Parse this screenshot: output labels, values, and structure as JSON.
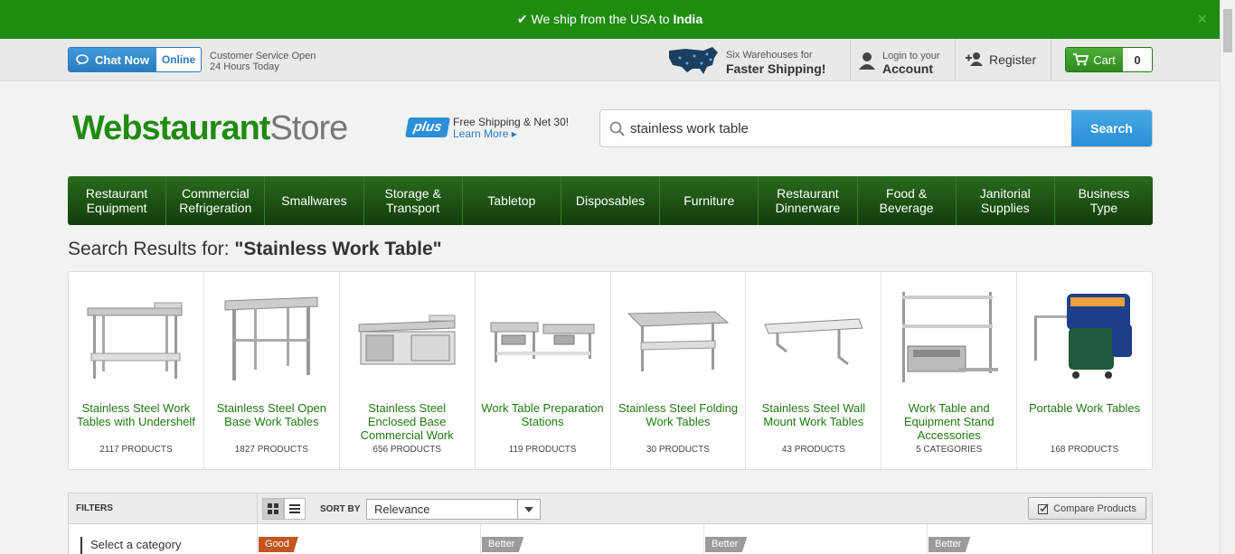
{
  "topbar": {
    "prefix": "We ship from the USA to ",
    "country": "India",
    "close": "×"
  },
  "header": {
    "chat_label": "Chat Now",
    "chat_status": "Online",
    "cs_line1": "Customer Service Open",
    "cs_line2": "24 Hours Today",
    "warehouse_line1": "Six Warehouses for",
    "warehouse_line2": "Faster Shipping!",
    "login_line1": "Login to your",
    "login_line2": "Account",
    "register": "Register",
    "cart_label": "Cart",
    "cart_count": "0"
  },
  "brand": {
    "logo_bold": "Webstaurant",
    "logo_light": "Store",
    "plus": "plus",
    "plus_line1": "Free Shipping & Net 30!",
    "plus_line2": "Learn More"
  },
  "search": {
    "value": "stainless work table",
    "button": "Search"
  },
  "nav": [
    {
      "l1": "Restaurant",
      "l2": "Equipment"
    },
    {
      "l1": "Commercial",
      "l2": "Refrigeration"
    },
    {
      "l1": "Smallwares",
      "l2": ""
    },
    {
      "l1": "Storage &",
      "l2": "Transport"
    },
    {
      "l1": "Tabletop",
      "l2": ""
    },
    {
      "l1": "Disposables",
      "l2": ""
    },
    {
      "l1": "Furniture",
      "l2": ""
    },
    {
      "l1": "Restaurant",
      "l2": "Dinnerware"
    },
    {
      "l1": "Food &",
      "l2": "Beverage"
    },
    {
      "l1": "Janitorial",
      "l2": "Supplies"
    },
    {
      "l1": "Business",
      "l2": "Type"
    }
  ],
  "results": {
    "prefix": "Search Results for: ",
    "query": "\"Stainless Work Table\""
  },
  "categories": [
    {
      "name": "Stainless Steel Work Tables with Undershelf",
      "count": "2117 PRODUCTS"
    },
    {
      "name": "Stainless Steel Open Base Work Tables",
      "count": "1827 PRODUCTS"
    },
    {
      "name": "Stainless Steel Enclosed Base Commercial Work",
      "count": "656 PRODUCTS"
    },
    {
      "name": "Work Table Preparation Stations",
      "count": "119 PRODUCTS"
    },
    {
      "name": "Stainless Steel Folding Work Tables",
      "count": "30 PRODUCTS"
    },
    {
      "name": "Stainless Steel Wall Mount Work Tables",
      "count": "43 PRODUCTS"
    },
    {
      "name": "Work Table and Equipment Stand Accessories",
      "count": "5 CATEGORIES"
    },
    {
      "name": "Portable Work Tables",
      "count": "168 PRODUCTS"
    }
  ],
  "filters": {
    "label": "FILTERS",
    "sort_label": "SORT BY",
    "sort_value": "Relevance",
    "compare": "Compare Products",
    "select_category": "Select a category"
  },
  "badges": [
    "Good",
    "Better",
    "Better",
    "Better"
  ]
}
